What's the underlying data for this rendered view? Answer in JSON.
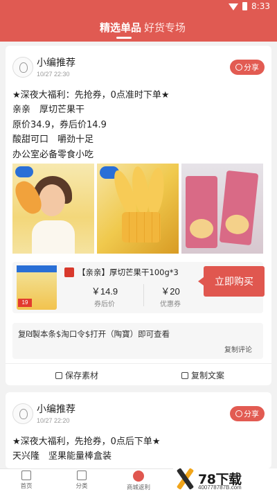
{
  "status_bar": {
    "time": "8:33"
  },
  "top_nav": {
    "tabs": [
      "精选单品",
      "好货专场"
    ],
    "active_tab": 0
  },
  "posts": [
    {
      "author": "小编推荐",
      "time": "10/27 22:30",
      "share_label": "分享",
      "lines": [
        "★深夜大福利：先抢券，0点准时下单★",
        "亲亲　厚切芒果干",
        "原价34.9，券后价14.9",
        "酸甜可口　嚼劲十足",
        "办公室必备零食小吃"
      ],
      "product": {
        "badge": "19",
        "title": "【亲亲】厚切芒果干100g*3",
        "price": "￥14.9",
        "price_label": "券后价",
        "coupon": "￥20",
        "coupon_label": "优惠券",
        "buy_label": "立即购买"
      },
      "comment": "复₪製本条$淘口令$打开（陶寶）即可查看",
      "copy_comment_label": "复制评论",
      "save_label": "保存素材",
      "copy_text_label": "复制文案"
    },
    {
      "author": "小编推荐",
      "time": "10/27 22:20",
      "share_label": "分享",
      "lines": [
        "★深夜大福利，先抢券，0点后下单★",
        "天兴隆　坚果能量棒盒装"
      ]
    }
  ],
  "bottom_nav": {
    "items": [
      "首页",
      "分类",
      "商城返利"
    ]
  },
  "watermark": {
    "brand": "78下载",
    "url": "400778787B.com"
  },
  "colors": {
    "accent": "#e05a52"
  }
}
